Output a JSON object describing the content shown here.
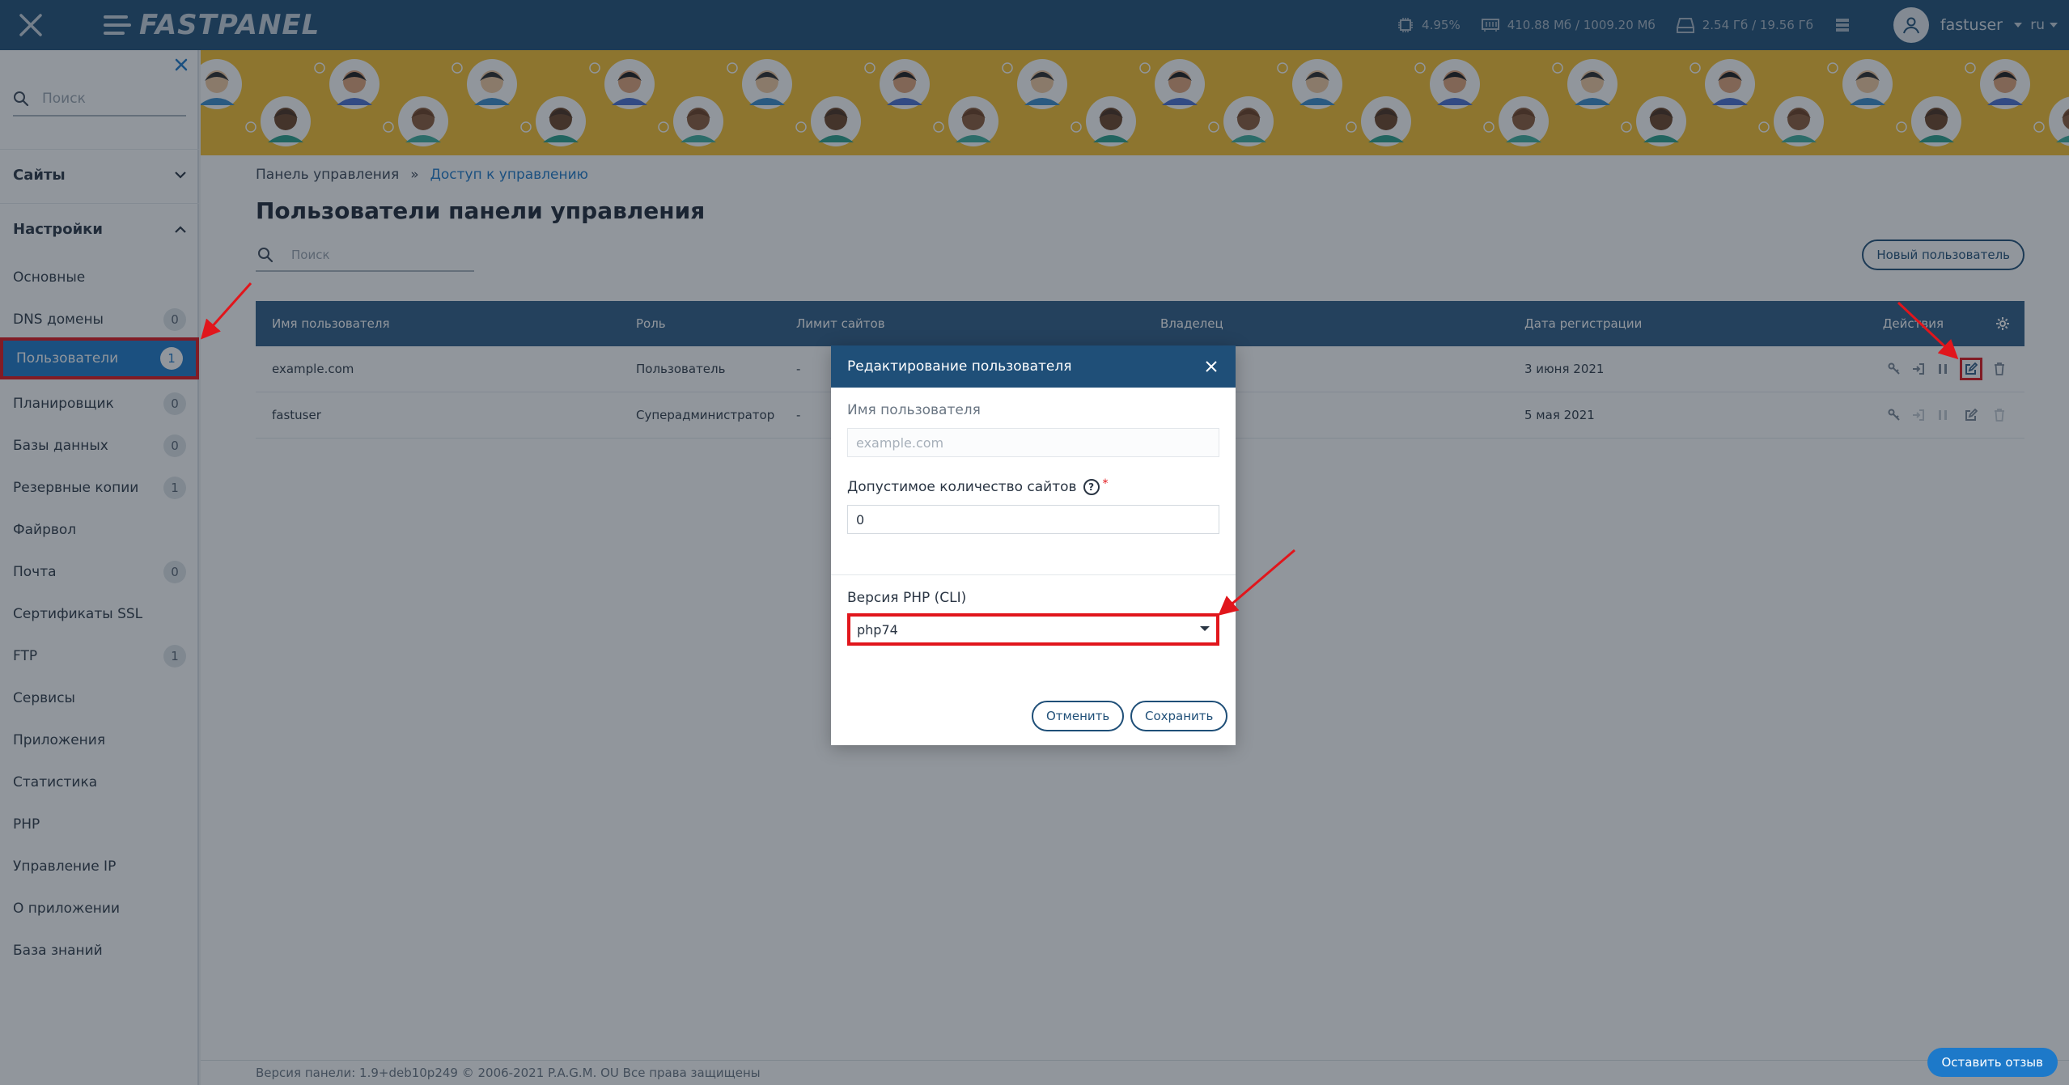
{
  "topbar": {
    "brand": "FASTPANEL",
    "cpu": "4.95%",
    "ram": "410.88 Мб / 1009.20 Мб",
    "disk": "2.54 Гб / 19.56 Гб",
    "username": "fastuser",
    "language": "ru"
  },
  "sidebar": {
    "search_placeholder": "Поиск",
    "sections": {
      "sites": "Сайты",
      "settings": "Настройки"
    },
    "items": [
      {
        "label": "Основные",
        "badge": ""
      },
      {
        "label": "DNS домены",
        "badge": "0"
      },
      {
        "label": "Пользователи",
        "badge": "1"
      },
      {
        "label": "Планировщик",
        "badge": "0"
      },
      {
        "label": "Базы данных",
        "badge": "0"
      },
      {
        "label": "Резервные копии",
        "badge": "1"
      },
      {
        "label": "Файрвол",
        "badge": ""
      },
      {
        "label": "Почта",
        "badge": "0"
      },
      {
        "label": "Сертификаты SSL",
        "badge": ""
      },
      {
        "label": "FTP",
        "badge": "1"
      },
      {
        "label": "Сервисы",
        "badge": ""
      },
      {
        "label": "Приложения",
        "badge": ""
      },
      {
        "label": "Статистика",
        "badge": ""
      },
      {
        "label": "PHP",
        "badge": ""
      },
      {
        "label": "Управление IP",
        "badge": ""
      },
      {
        "label": "О приложении",
        "badge": ""
      },
      {
        "label": "База знаний",
        "badge": ""
      }
    ]
  },
  "breadcrumb": {
    "root": "Панель управления",
    "separator": "»",
    "current": "Доступ к управлению"
  },
  "page": {
    "title": "Пользователи панели управления",
    "search_placeholder": "Поиск",
    "new_user_button": "Новый пользователь"
  },
  "table": {
    "columns": [
      "Имя пользователя",
      "Роль",
      "Лимит сайтов",
      "Владелец",
      "Дата регистрации",
      "Действия"
    ],
    "rows": [
      {
        "name": "example.com",
        "role": "Пользователь",
        "limit": "-",
        "owner": "",
        "date": "3 июня 2021"
      },
      {
        "name": "fastuser",
        "role": "Суперадминистратор",
        "limit": "-",
        "owner": "",
        "date": "5 мая 2021"
      }
    ]
  },
  "modal": {
    "title": "Редактирование пользователя",
    "username_label": "Имя пользователя",
    "username_value": "example.com",
    "sites_label": "Допустимое количество сайтов",
    "sites_value": "0",
    "php_label": "Версия PHP (CLI)",
    "php_value": "php74",
    "cancel": "Отменить",
    "save": "Сохранить"
  },
  "footer": {
    "text": "Версия панели: 1.9+deb10p249 © 2006-2021 P.A.G.M. OU Все права защищены",
    "feedback": "Оставить отзыв"
  },
  "colors": {
    "header": "#1f4f78",
    "accent": "#1d79c9",
    "banner": "#f7c02e",
    "highlight": "#e1161c"
  }
}
